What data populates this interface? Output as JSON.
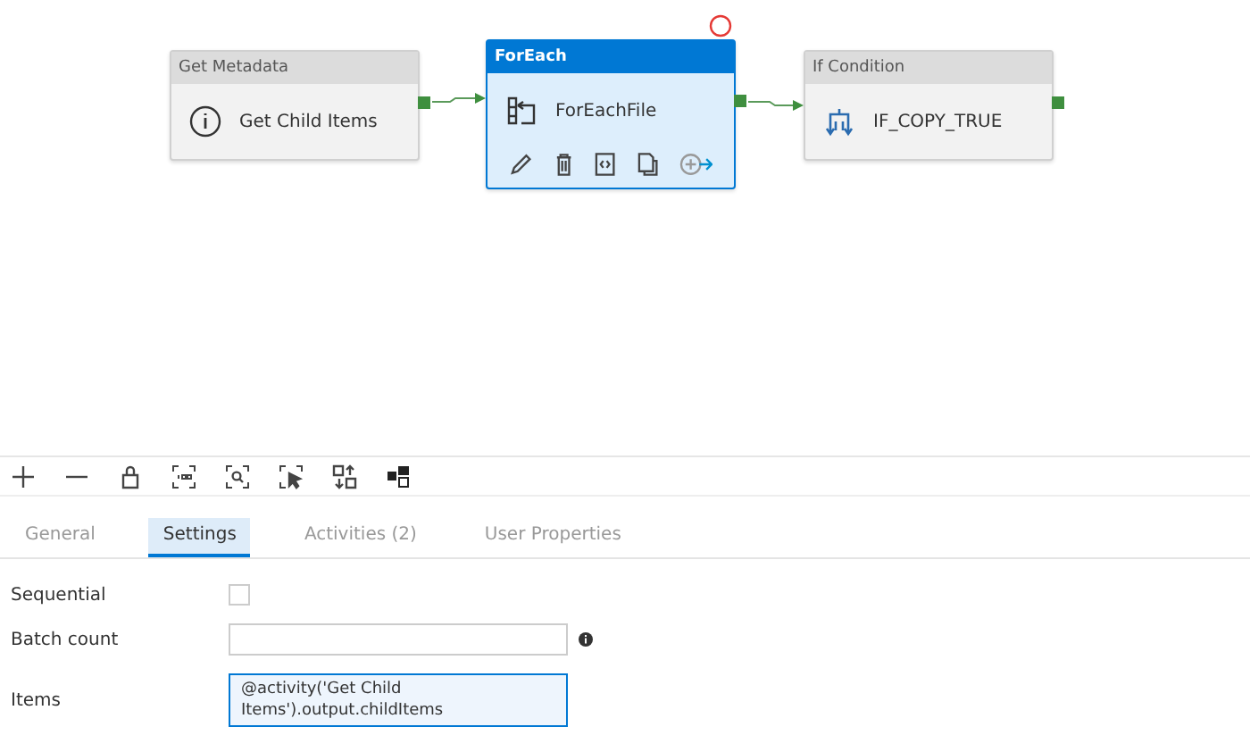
{
  "pipeline": {
    "activities": [
      {
        "kind": "get_metadata",
        "type_label": "Get Metadata",
        "name": "Get Child Items",
        "selected": false
      },
      {
        "kind": "foreach",
        "type_label": "ForEach",
        "name": "ForEachFile",
        "selected": true
      },
      {
        "kind": "if_condition",
        "type_label": "If Condition",
        "name": "IF_COPY_TRUE",
        "selected": false
      }
    ]
  },
  "tabs": [
    {
      "label": "General",
      "selected": false
    },
    {
      "label": "Settings",
      "selected": true
    },
    {
      "label": "Activities (2)",
      "selected": false
    },
    {
      "label": "User Properties",
      "selected": false
    }
  ],
  "settings": {
    "sequential": {
      "label": "Sequential",
      "checked": false
    },
    "batch_count": {
      "label": "Batch count"
    },
    "items": {
      "label": "Items",
      "value": "@activity('Get Child Items').output.childItems"
    }
  }
}
